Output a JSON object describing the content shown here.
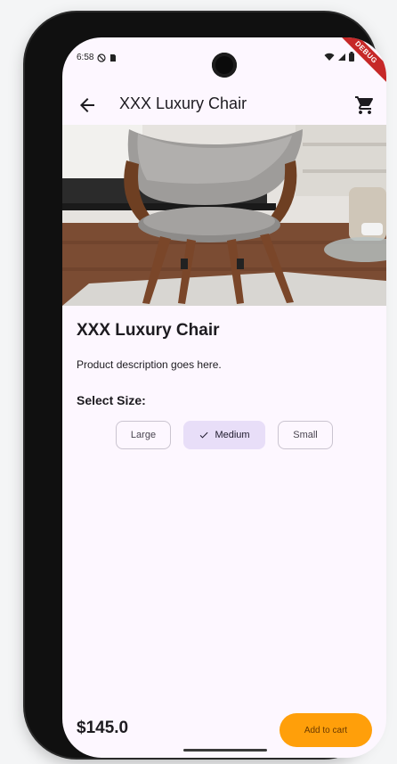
{
  "status_bar": {
    "time": "6:58",
    "debug_label": "DEBUG"
  },
  "app_bar": {
    "title": "XXX Luxury Chair"
  },
  "product": {
    "title": "XXX Luxury Chair",
    "description": "Product description goes here.",
    "price": "$145.0"
  },
  "size_selector": {
    "label": "Select Size:",
    "options": [
      {
        "label": "Large",
        "selected": false
      },
      {
        "label": "Medium",
        "selected": true
      },
      {
        "label": "Small",
        "selected": false
      }
    ]
  },
  "actions": {
    "add_to_cart_label": "Add to cart"
  },
  "colors": {
    "background": "#fdf7ff",
    "selected_chip": "#e8def8",
    "add_to_cart": "#ff9f0a",
    "debug_ribbon": "#c62828"
  },
  "icons": {
    "back": "arrow-back-icon",
    "cart": "shopping-cart-icon",
    "check": "check-icon"
  }
}
